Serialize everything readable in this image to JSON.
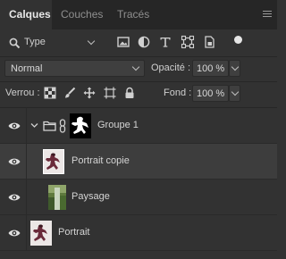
{
  "tabs": [
    {
      "label": "Calques",
      "active": true
    },
    {
      "label": "Couches",
      "active": false
    },
    {
      "label": "Tracés",
      "active": false
    }
  ],
  "filter": {
    "kind_label": "Type",
    "icons": [
      "image-filter-icon",
      "adjustment-filter-icon",
      "text-filter-icon",
      "shape-filter-icon",
      "smart-object-filter-icon",
      "filter-toggle"
    ]
  },
  "blend": {
    "mode": "Normal",
    "opacity_label": "Opacité :",
    "opacity_value": "100 %"
  },
  "lock": {
    "label": "Verrou :",
    "icons": [
      "lock-transparent-pixels-icon",
      "lock-image-pixels-icon",
      "lock-position-icon",
      "lock-artboard-icon",
      "lock-all-icon"
    ],
    "fill_label": "Fond :",
    "fill_value": "100 %"
  },
  "layers": [
    {
      "name": "Groupe 1",
      "type": "group",
      "visible": true,
      "expanded": true,
      "selected": false
    },
    {
      "name": "Portrait copie",
      "type": "image",
      "visible": true,
      "selected": true
    },
    {
      "name": "Paysage",
      "type": "image",
      "visible": true,
      "selected": false
    },
    {
      "name": "Portrait",
      "type": "image",
      "visible": true,
      "selected": false
    }
  ],
  "colors": {
    "panel_bg": "#323232",
    "tab_bar_bg": "#262626",
    "selected_row_bg": "#3d3d3d"
  }
}
